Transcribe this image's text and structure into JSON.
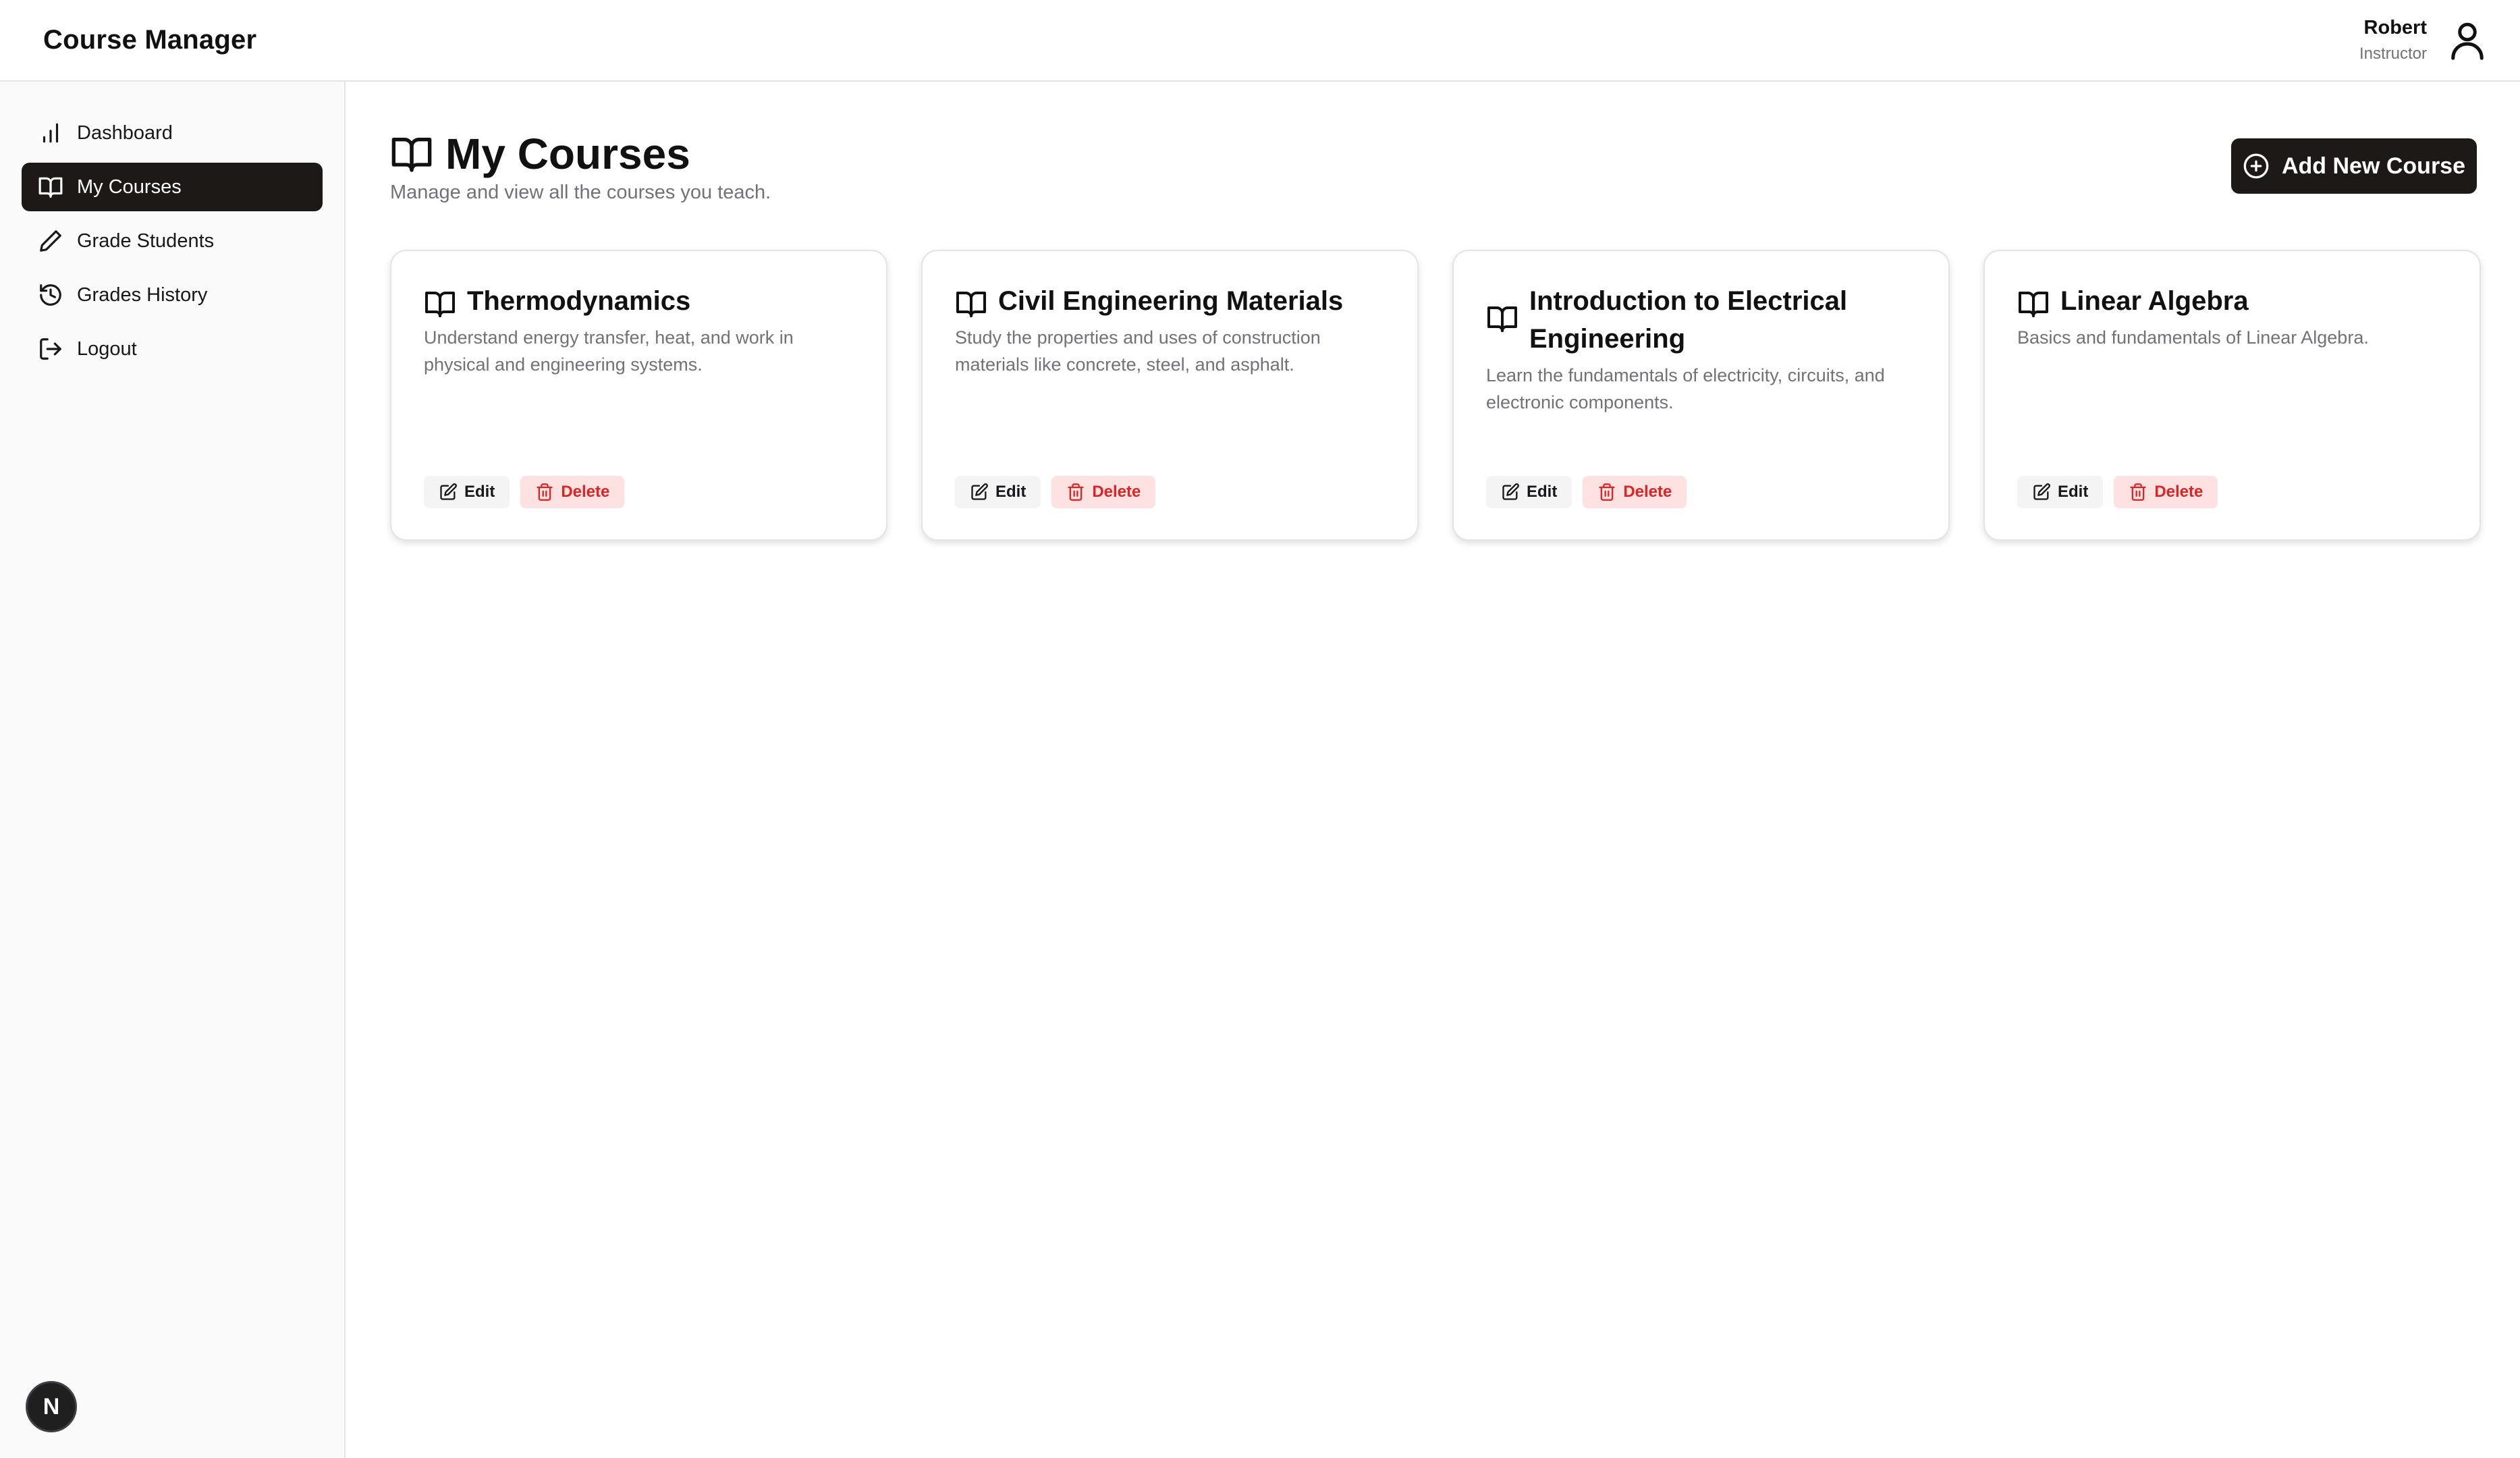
{
  "app": {
    "title": "Course Manager"
  },
  "user": {
    "name": "Robert",
    "role": "Instructor"
  },
  "sidebar": {
    "items": [
      {
        "label": "Dashboard",
        "icon": "bar-chart-icon"
      },
      {
        "label": "My Courses",
        "icon": "book-open-icon",
        "active": true
      },
      {
        "label": "Grade Students",
        "icon": "pencil-icon"
      },
      {
        "label": "Grades History",
        "icon": "history-icon"
      },
      {
        "label": "Logout",
        "icon": "logout-icon"
      }
    ],
    "badge": "N"
  },
  "page": {
    "title": "My Courses",
    "subtitle": "Manage and view all the courses you teach.",
    "add_button": "Add New Course"
  },
  "courses": [
    {
      "title": "Thermodynamics",
      "description": "Understand energy transfer, heat, and work in physical and engineering systems.",
      "edit": "Edit",
      "delete": "Delete"
    },
    {
      "title": "Civil Engineering Materials",
      "description": "Study the properties and uses of construction materials like concrete, steel, and asphalt.",
      "edit": "Edit",
      "delete": "Delete"
    },
    {
      "title": "Introduction to Electrical Engineering",
      "description": "Learn the fundamentals of electricity, circuits, and electronic components.",
      "edit": "Edit",
      "delete": "Delete"
    },
    {
      "title": "Linear Algebra",
      "description": "Basics and fundamentals of Linear Algebra.",
      "edit": "Edit",
      "delete": "Delete"
    }
  ],
  "colors": {
    "primary": "#1c1917",
    "danger": "#dc2626",
    "danger_bg": "#fee2e2",
    "muted": "#71717a"
  }
}
